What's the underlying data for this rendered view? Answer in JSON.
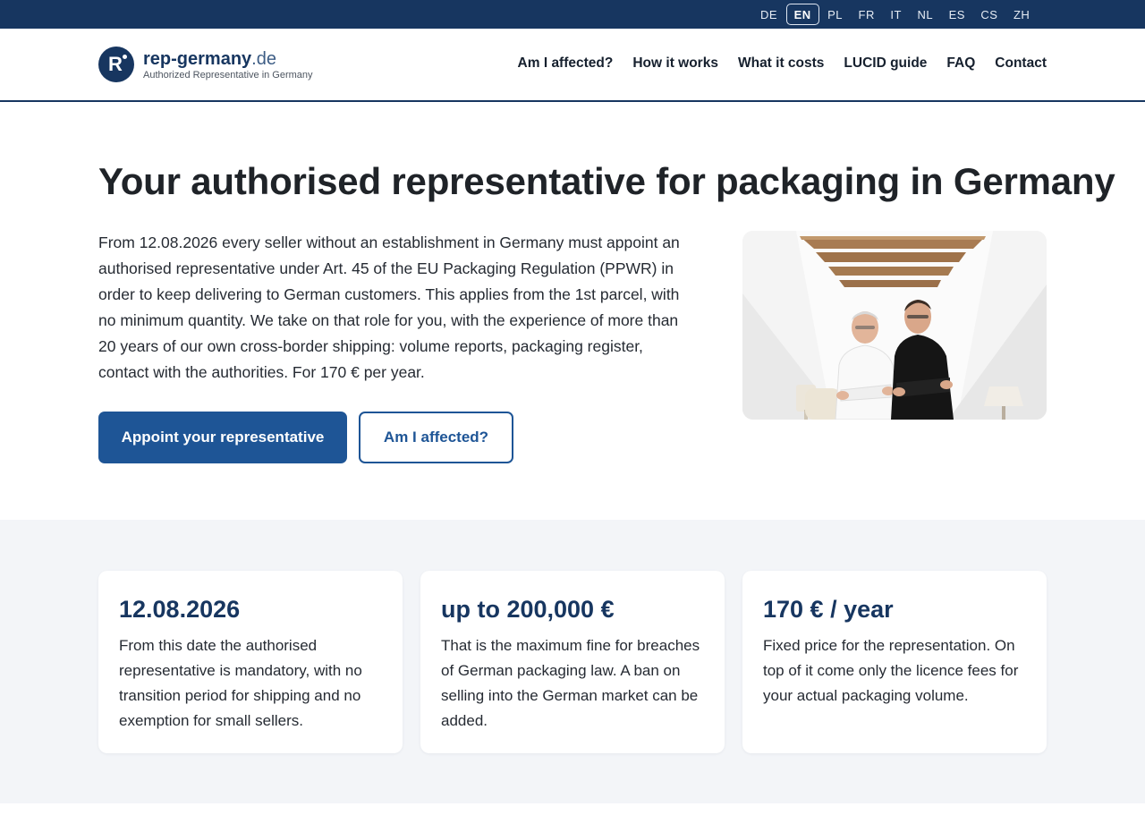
{
  "languages": {
    "items": [
      "DE",
      "EN",
      "PL",
      "FR",
      "IT",
      "NL",
      "ES",
      "CS",
      "ZH"
    ],
    "active": "EN"
  },
  "brand": {
    "logo_letter": "R",
    "name_bold": "rep-germany",
    "name_tld": ".de",
    "tagline": "Authorized Representative in Germany"
  },
  "nav": {
    "affected": "Am I affected?",
    "how": "How it works",
    "costs": "What it costs",
    "lucid": "LUCID guide",
    "faq": "FAQ",
    "contact": "Contact"
  },
  "hero": {
    "title": "Your authorised representative for packaging in Germany",
    "intro": "From 12.08.2026 every seller without an establishment in Germany must appoint an authorised representative under Art. 45 of the EU Packaging Regulation (PPWR) in order to keep delivering to German customers. This applies from the 1st parcel, with no minimum quantity. We take on that role for you, with the experience of more than 20 years of our own cross-border shipping: volume reports, packaging register, contact with the authorities. For 170 € per year.",
    "primary_button": "Appoint your representative",
    "secondary_button": "Am I affected?",
    "photo_alt": "Two men with crossed arms standing under wooden beams"
  },
  "stats": [
    {
      "heading": "12.08.2026",
      "text": "From this date the authorised representative is mandatory, with no transition period for shipping and no exemption for small sellers."
    },
    {
      "heading": "up to 200,000 €",
      "text": "That is the maximum fine for breaches of German packaging law. A ban on selling into the German market can be added."
    },
    {
      "heading": "170 € / year",
      "text": "Fixed price for the representation. On top of it come only the licence fees for your actual packaging volume."
    }
  ],
  "colors": {
    "navy": "#173660",
    "primary": "#1e5596",
    "stats_bg": "#f3f5f8"
  }
}
